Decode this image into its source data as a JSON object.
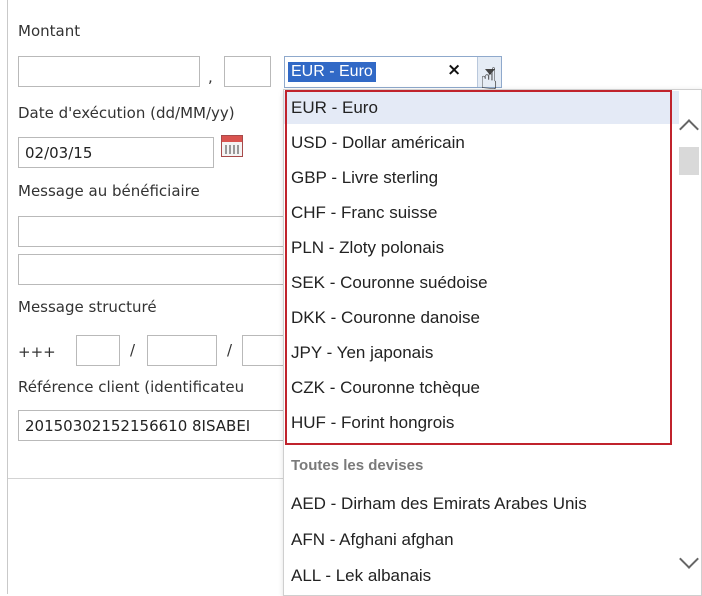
{
  "form": {
    "amount_label": "Montant",
    "decimal_sep": ",",
    "date_label": "Date d'exécution (dd/MM/yy)",
    "date_value": "02/03/15",
    "message_label": "Message au bénéficiaire",
    "structured_label": "Message structuré",
    "structured_prefix": "+++",
    "slash": "/",
    "reference_label": "Référence client (identificateu",
    "reference_value": "20150302152156610 8ISABEI"
  },
  "currency": {
    "selected": "EUR - Euro",
    "clear_glyph": "×"
  },
  "dropdown": {
    "favorites": [
      "EUR - Euro",
      "USD - Dollar américain",
      "GBP - Livre sterling",
      "CHF - Franc suisse",
      "PLN - Zloty polonais",
      "SEK - Couronne suédoise",
      "DKK - Couronne danoise",
      "JPY - Yen japonais",
      "CZK - Couronne tchèque",
      "HUF - Forint hongrois"
    ],
    "group_label": "Toutes les devises",
    "all": [
      "AED - Dirham des Emirats Arabes Unis",
      "AFN - Afghani afghan",
      "ALL - Lek albanais"
    ]
  },
  "colors": {
    "highlight_box": "#c0232c",
    "selection": "#3169c6"
  },
  "icons": [
    "calendar-icon",
    "hand-cursor-icon",
    "chevron-up-icon",
    "chevron-down-icon",
    "close-icon",
    "dropdown-arrow-icon"
  ]
}
